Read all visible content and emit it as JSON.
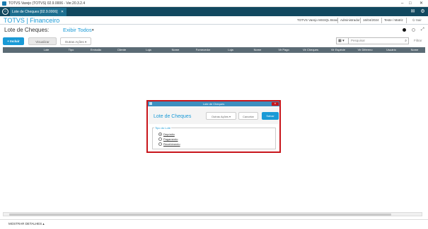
{
  "window": {
    "title": "TOTVS Varejo (TOTVS) 02.9.0006 - Ver.20.3.2.4",
    "min": "–",
    "max": "□",
    "close": "✕"
  },
  "tabbar": {
    "tab_label": "Lote de Cheques [02.9.0006]",
    "tab_close": "✕",
    "chat_icon": "✉",
    "settings_icon": "⚙"
  },
  "header": {
    "brand": "TOTVS | Financeiro",
    "environment": "TOTVS Varejo MSSQL Brasil",
    "user": "Administrador",
    "date": "16/04/2024",
    "branch": "Teste / Matriz",
    "exit": "Sair"
  },
  "page": {
    "title": "Lote de Cheques:",
    "view": "Exibir Todos",
    "view_caret": "▾"
  },
  "toolbar": {
    "incluir": "+ Incluir",
    "visualizar": "Visualizar",
    "outras_acoes": "Outras Ações ▾",
    "grid_toggle": "▦ ▾",
    "search_placeholder": "Pesquisar",
    "search_icon": "⌕",
    "filtrar": "Filtrar"
  },
  "table": {
    "columns": [
      "",
      "Lote",
      "Tipo",
      "Emissão",
      "Cliente",
      "Loja",
      "Nome",
      "Fornecedor",
      "Loja",
      "Nome",
      "Vlr Pago",
      "Vlr Cheques",
      "Vlr Espécie",
      "Vlr Difereno",
      "Usuário",
      "Nome"
    ]
  },
  "footer": {
    "detalhes": "MOSTRAR DETALHES ▴"
  },
  "modal": {
    "title": "Lote de Cheques",
    "close": "✕",
    "heading": "Lote de Cheques",
    "outras_acoes": "Outras Ações ▾",
    "cancelar": "Cancelar",
    "salvar": "Salvar",
    "legend": "Tipo do Lote",
    "options": [
      "Depósito",
      "Pagamento",
      "Recebimento"
    ],
    "selected": 0
  },
  "colors": {
    "accent": "#1a9ad6",
    "tabbar": "#11485f",
    "highlight": "#c8151b",
    "table_header": "#5b6b75"
  }
}
